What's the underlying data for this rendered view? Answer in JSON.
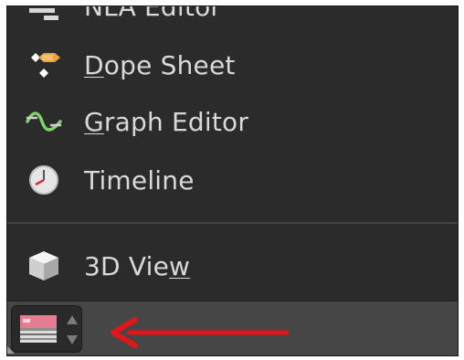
{
  "menu": {
    "items": [
      {
        "id": "nla",
        "label": "NLA Editor",
        "icon": "nla-editor-icon"
      },
      {
        "id": "dope",
        "label_pre": "",
        "label_mn": "D",
        "label_post": "ope Sheet",
        "icon": "dope-sheet-icon"
      },
      {
        "id": "graph",
        "label_pre": "",
        "label_mn": "G",
        "label_post": "raph Editor",
        "icon": "graph-editor-icon"
      },
      {
        "id": "timeline",
        "label": "Timeline",
        "icon": "timeline-icon"
      },
      {
        "id": "view3d",
        "label_pre": "3D Vie",
        "label_mn": "w",
        "label_post": "",
        "icon": "3d-view-icon"
      }
    ]
  },
  "header": {
    "editor_type_icon": "image-editor-icon",
    "annotation": "red-arrow-pointer"
  },
  "colors": {
    "menu_bg": "#2b2b2b",
    "header_bg": "#464646",
    "text": "#d9d9d9",
    "arrow": "#e0161a",
    "graph_green": "#7fd36b"
  }
}
